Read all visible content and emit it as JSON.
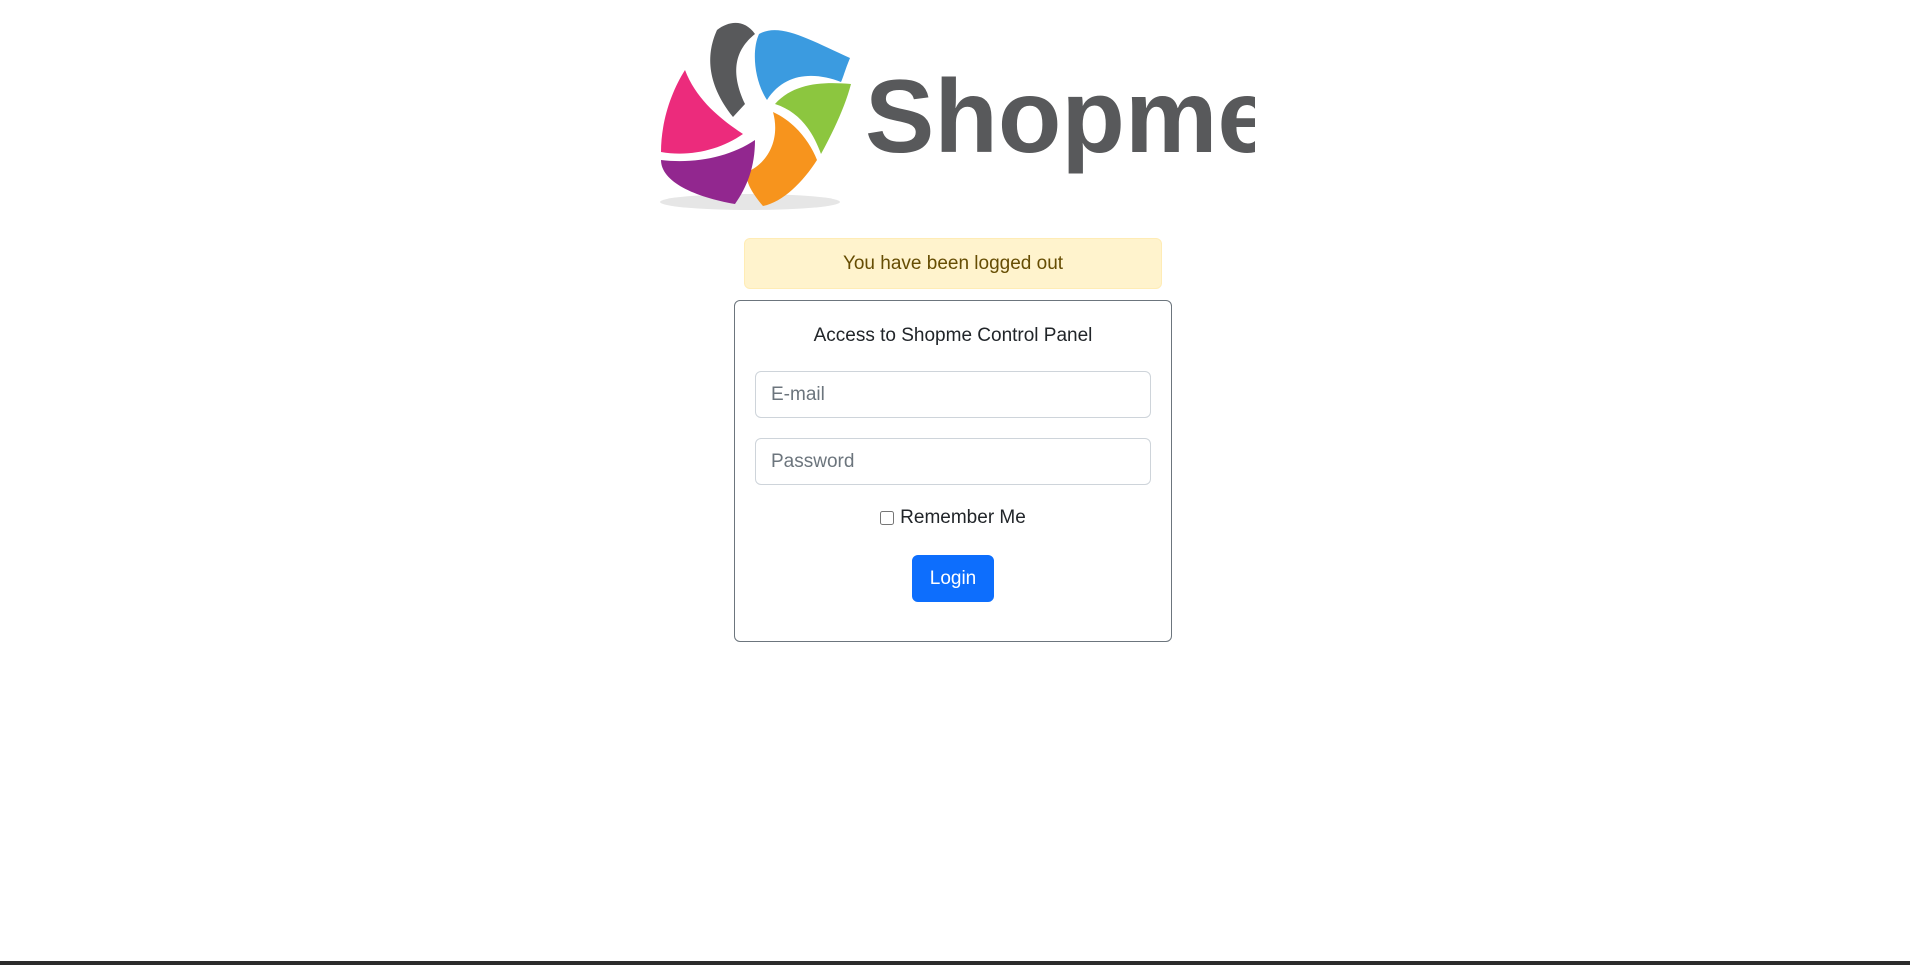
{
  "logo": {
    "brand_text": "Shopme",
    "colors": {
      "dark_gray": "#58595b",
      "blue": "#3b9be0",
      "green": "#8cc63f",
      "orange": "#f7941d",
      "purple": "#92278f",
      "pink": "#ec2b7c",
      "shadow": "#e6e6e6"
    }
  },
  "alert": {
    "message": "You have been logged out",
    "background": "#fff3cd",
    "text_color": "#664d03"
  },
  "login_form": {
    "title": "Access to Shopme Control Panel",
    "email_placeholder": "E-mail",
    "email_value": "",
    "password_placeholder": "Password",
    "password_value": "",
    "remember_label": "Remember Me",
    "remember_checked": false,
    "submit_label": "Login",
    "accent": "#0d6efd"
  }
}
